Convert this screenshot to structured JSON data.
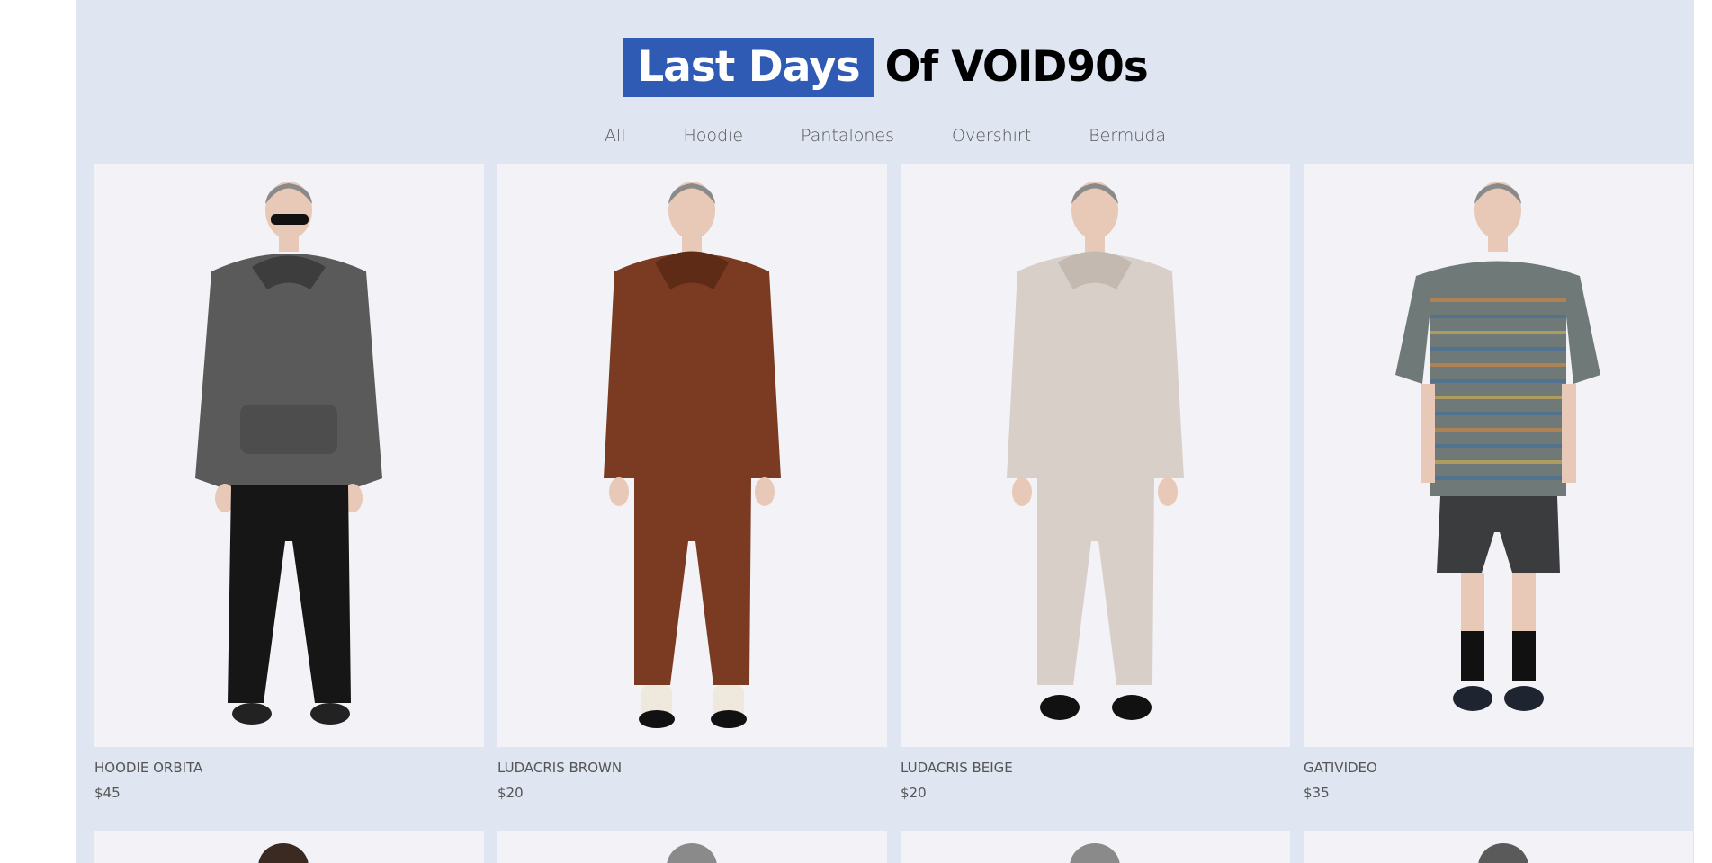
{
  "heading": {
    "highlight": "Last Days",
    "rest": "Of VOID90s"
  },
  "filters": [
    "All",
    "Hoodie",
    "Pantalones",
    "Overshirt",
    "Bermuda"
  ],
  "products": [
    {
      "name": "HOODIE ORBITA",
      "price": "$45",
      "top_color": "#5a5a5a",
      "bottom_color": "#161616"
    },
    {
      "name": "LUDACRIS BROWN",
      "price": "$20",
      "top_color": "#7a3b22",
      "bottom_color": "#7a3b22"
    },
    {
      "name": "LUDACRIS BEIGE",
      "price": "$20",
      "top_color": "#d8cfc8",
      "bottom_color": "#d8cfc8"
    },
    {
      "name": "GATIVIDEO",
      "price": "$35",
      "top_color": "#6f7a78",
      "bottom_color": "#3b3c3e"
    }
  ],
  "colors": {
    "accent": "#2f5bb5",
    "background": "#dfe5f1"
  }
}
